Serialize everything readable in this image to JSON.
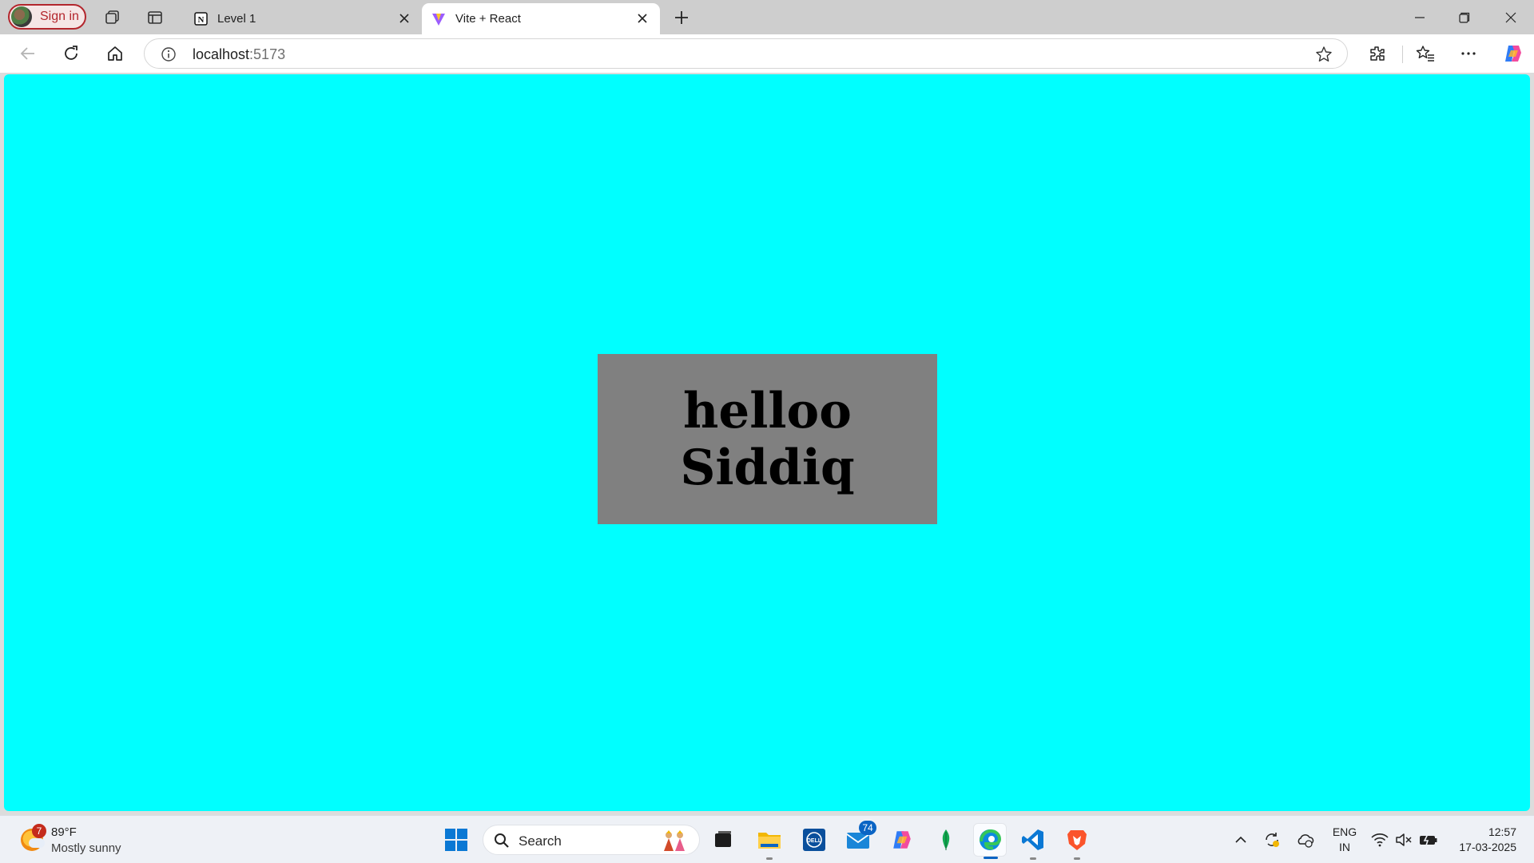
{
  "browser": {
    "profile": {
      "label": "Sign in"
    },
    "tabs": [
      {
        "title": "Level 1",
        "favicon": "notion-icon",
        "active": false
      },
      {
        "title": "Vite + React",
        "favicon": "vite-icon",
        "active": true
      }
    ],
    "address": {
      "host": "localhost",
      "port": ":5173"
    }
  },
  "page": {
    "background": "#00ffff",
    "card_background": "#808080",
    "heading_line1": "helloo",
    "heading_line2": "Siddiq"
  },
  "taskbar": {
    "weather": {
      "badge": "7",
      "temp": "89°F",
      "condition": "Mostly sunny"
    },
    "search_placeholder": "Search",
    "mail_badge": "74",
    "lang_line1": "ENG",
    "lang_line2": "IN",
    "time": "12:57",
    "date": "17-03-2025"
  },
  "colors": {
    "accent": "#0a64c4",
    "signin_red": "#b3262d"
  }
}
